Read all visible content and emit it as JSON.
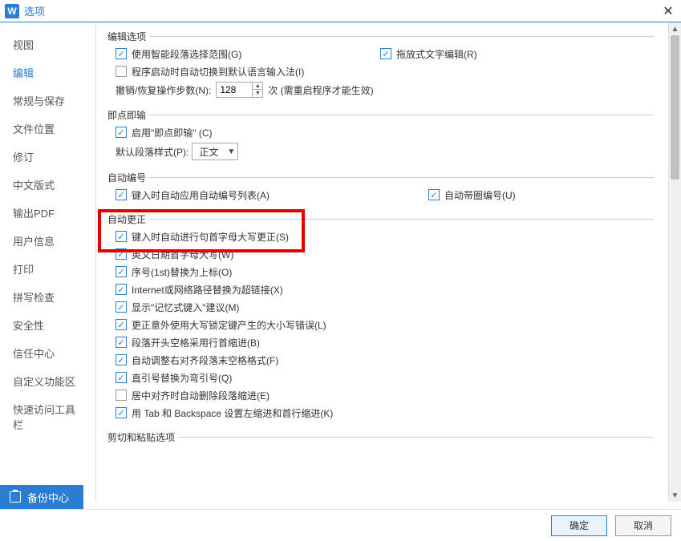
{
  "window": {
    "title": "选项"
  },
  "sidebar": {
    "items": [
      {
        "label": "视图"
      },
      {
        "label": "编辑",
        "active": true
      },
      {
        "label": "常规与保存"
      },
      {
        "label": "文件位置"
      },
      {
        "label": "修订"
      },
      {
        "label": "中文版式"
      },
      {
        "label": "输出PDF"
      },
      {
        "label": "用户信息"
      },
      {
        "label": "打印"
      },
      {
        "label": "拼写检查"
      },
      {
        "label": "安全性"
      },
      {
        "label": "信任中心"
      },
      {
        "label": "自定义功能区"
      },
      {
        "label": "快速访问工具栏"
      }
    ]
  },
  "groups": {
    "edit": {
      "title": "编辑选项",
      "smart_range": {
        "label": "使用智能段落选择范围(G)",
        "checked": true
      },
      "drag_edit": {
        "label": "拖放式文字编辑(R)",
        "checked": true
      },
      "start_ime": {
        "label": "程序启动时自动切换到默认语言输入法(I)",
        "checked": false
      },
      "undo_label": "撤销/恢复操作步数(N):",
      "undo_value": "128",
      "undo_note": "次 (需重启程序才能生效)"
    },
    "clicktype": {
      "title": "即点即输",
      "enable": {
        "label": "启用\"即点即输\" (C)",
        "checked": true
      },
      "paragraph_label": "默认段落样式(P):",
      "paragraph_value": "正文"
    },
    "autonum": {
      "title": "自动编号",
      "apply_list": {
        "label": "键入时自动应用自动编号列表(A)",
        "checked": true
      },
      "circle_num": {
        "label": "自动带圈编号(U)",
        "checked": true
      }
    },
    "autocorrect": {
      "title": "自动更正",
      "items": [
        {
          "label": "键入时自动进行句首字母大写更正(S)",
          "checked": true
        },
        {
          "label": "英文日期首字母大写(W)",
          "checked": true
        },
        {
          "label": "序号(1st)替换为上标(O)",
          "checked": true
        },
        {
          "label": "Internet或网络路径替换为超链接(X)",
          "checked": true
        },
        {
          "label": "显示\"记忆式键入\"建议(M)",
          "checked": true
        },
        {
          "label": "更正意外使用大写锁定键产生的大小写错误(L)",
          "checked": true
        },
        {
          "label": "段落开头空格采用行首缩进(B)",
          "checked": true
        },
        {
          "label": "自动调整右对齐段落末空格格式(F)",
          "checked": true
        },
        {
          "label": "直引号替换为弯引号(Q)",
          "checked": true
        },
        {
          "label": "居中对齐时自动删除段落缩进(E)",
          "checked": false
        },
        {
          "label": "用 Tab 和 Backspace 设置左缩进和首行缩进(K)",
          "checked": true
        }
      ]
    },
    "cutpaste": {
      "title": "剪切和粘贴选项"
    }
  },
  "backup": {
    "label": "备份中心"
  },
  "buttons": {
    "ok": "确定",
    "cancel": "取消"
  }
}
